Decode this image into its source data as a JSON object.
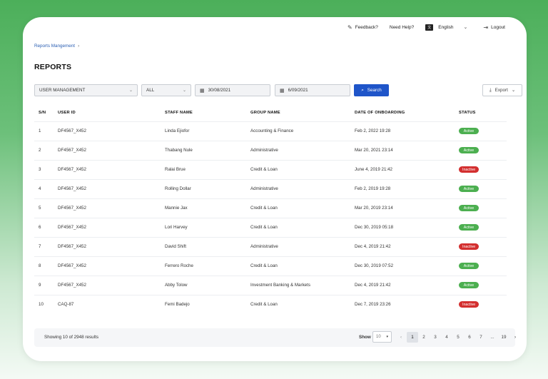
{
  "topbar": {
    "feedback": "Feedback?",
    "help": "Need Help?",
    "language": "English",
    "logout": "Logout"
  },
  "breadcrumb": {
    "item": "Reports Mangement"
  },
  "page": {
    "title": "REPORTS"
  },
  "filters": {
    "category": "USER MANAGEMENT",
    "status": "ALL",
    "date_from": "30/08/2021",
    "date_to": "6/09/2021",
    "search_label": "Search",
    "export_label": "Export"
  },
  "table": {
    "headers": [
      "S/N",
      "USER ID",
      "STAFF NAME",
      "GROUP NAME",
      "DATE OF ONBOARDING",
      "STATUS"
    ],
    "rows": [
      {
        "sn": "1",
        "user_id": "DF4567_X452",
        "staff": "Linda Ejiofor",
        "group": "Accounting & Finance",
        "date": "Feb 2, 2022 19:28",
        "status": "Active"
      },
      {
        "sn": "2",
        "user_id": "DF4567_X452",
        "staff": "Thabang Nule",
        "group": "Administrative",
        "date": "Mar 20, 2021 23:14",
        "status": "Active"
      },
      {
        "sn": "3",
        "user_id": "DF4567_X452",
        "staff": "Ralai Brue",
        "group": "Credit & Loan",
        "date": "June 4, 2019 21:42",
        "status": "Inactive"
      },
      {
        "sn": "4",
        "user_id": "DF4567_X452",
        "staff": "Rolling Dollar",
        "group": "Administrative",
        "date": "Feb 2, 2019 19:28",
        "status": "Active"
      },
      {
        "sn": "5",
        "user_id": "DF4567_X452",
        "staff": "Mannie Jax",
        "group": "Credit & Loan",
        "date": "Mar 20, 2019 23:14",
        "status": "Active"
      },
      {
        "sn": "6",
        "user_id": "DF4567_X452",
        "staff": "Lori Harvey",
        "group": "Credit & Loan",
        "date": "Dec 30, 2019 05:18",
        "status": "Active"
      },
      {
        "sn": "7",
        "user_id": "DF4567_X452",
        "staff": "David Shift",
        "group": "Administrative",
        "date": "Dec 4, 2019 21:42",
        "status": "Inactive"
      },
      {
        "sn": "8",
        "user_id": "DF4567_X452",
        "staff": "Ferrero Roche",
        "group": "Credit & Loan",
        "date": "Dec 30, 2019 07:52",
        "status": "Active"
      },
      {
        "sn": "9",
        "user_id": "DF4567_X452",
        "staff": "Abby Tolow",
        "group": "Investment Banking & Markets",
        "date": "Dec 4, 2019 21:42",
        "status": "Active"
      },
      {
        "sn": "10",
        "user_id": "CAQ-87",
        "staff": "Femi Badejo",
        "group": "Credit & Loan",
        "date": "Dec 7, 2019 23:26",
        "status": "Inactive"
      }
    ]
  },
  "footer": {
    "results_text": "Showing 10 of 2948 results",
    "show_label": "Show",
    "show_value": "10",
    "pages": [
      "1",
      "2",
      "3",
      "4",
      "5",
      "6",
      "7",
      "...",
      "19"
    ],
    "current_page": "1"
  },
  "colors": {
    "primary": "#1f55c9",
    "active": "#4caf50",
    "inactive": "#d32f2f",
    "background": "#4caf5a"
  }
}
